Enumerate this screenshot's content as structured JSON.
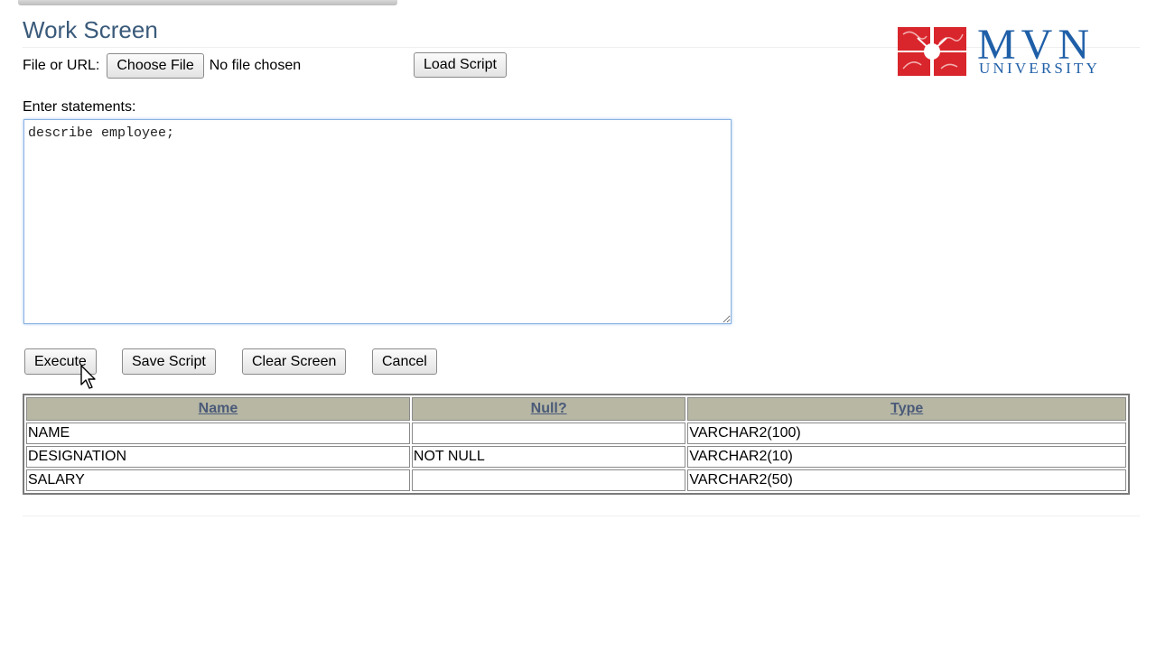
{
  "page": {
    "title": "Work Screen"
  },
  "file_row": {
    "label": "File or URL:",
    "choose_button": "Choose File",
    "file_status": "No file chosen",
    "load_button": "Load Script"
  },
  "logo": {
    "name": "MVN",
    "subtitle": "UNIVERSITY",
    "brand_color": "#1f5fa8",
    "mark_color": "#d9262c"
  },
  "editor": {
    "label": "Enter statements:",
    "value": "describe employee;"
  },
  "actions": {
    "execute": "Execute",
    "save": "Save Script",
    "clear": "Clear Screen",
    "cancel": "Cancel"
  },
  "results": {
    "columns": [
      "Name",
      "Null?",
      "Type"
    ],
    "rows": [
      [
        "NAME",
        "",
        "VARCHAR2(100)"
      ],
      [
        "DESIGNATION",
        "NOT NULL",
        "VARCHAR2(10)"
      ],
      [
        "SALARY",
        "",
        "VARCHAR2(50)"
      ]
    ]
  }
}
